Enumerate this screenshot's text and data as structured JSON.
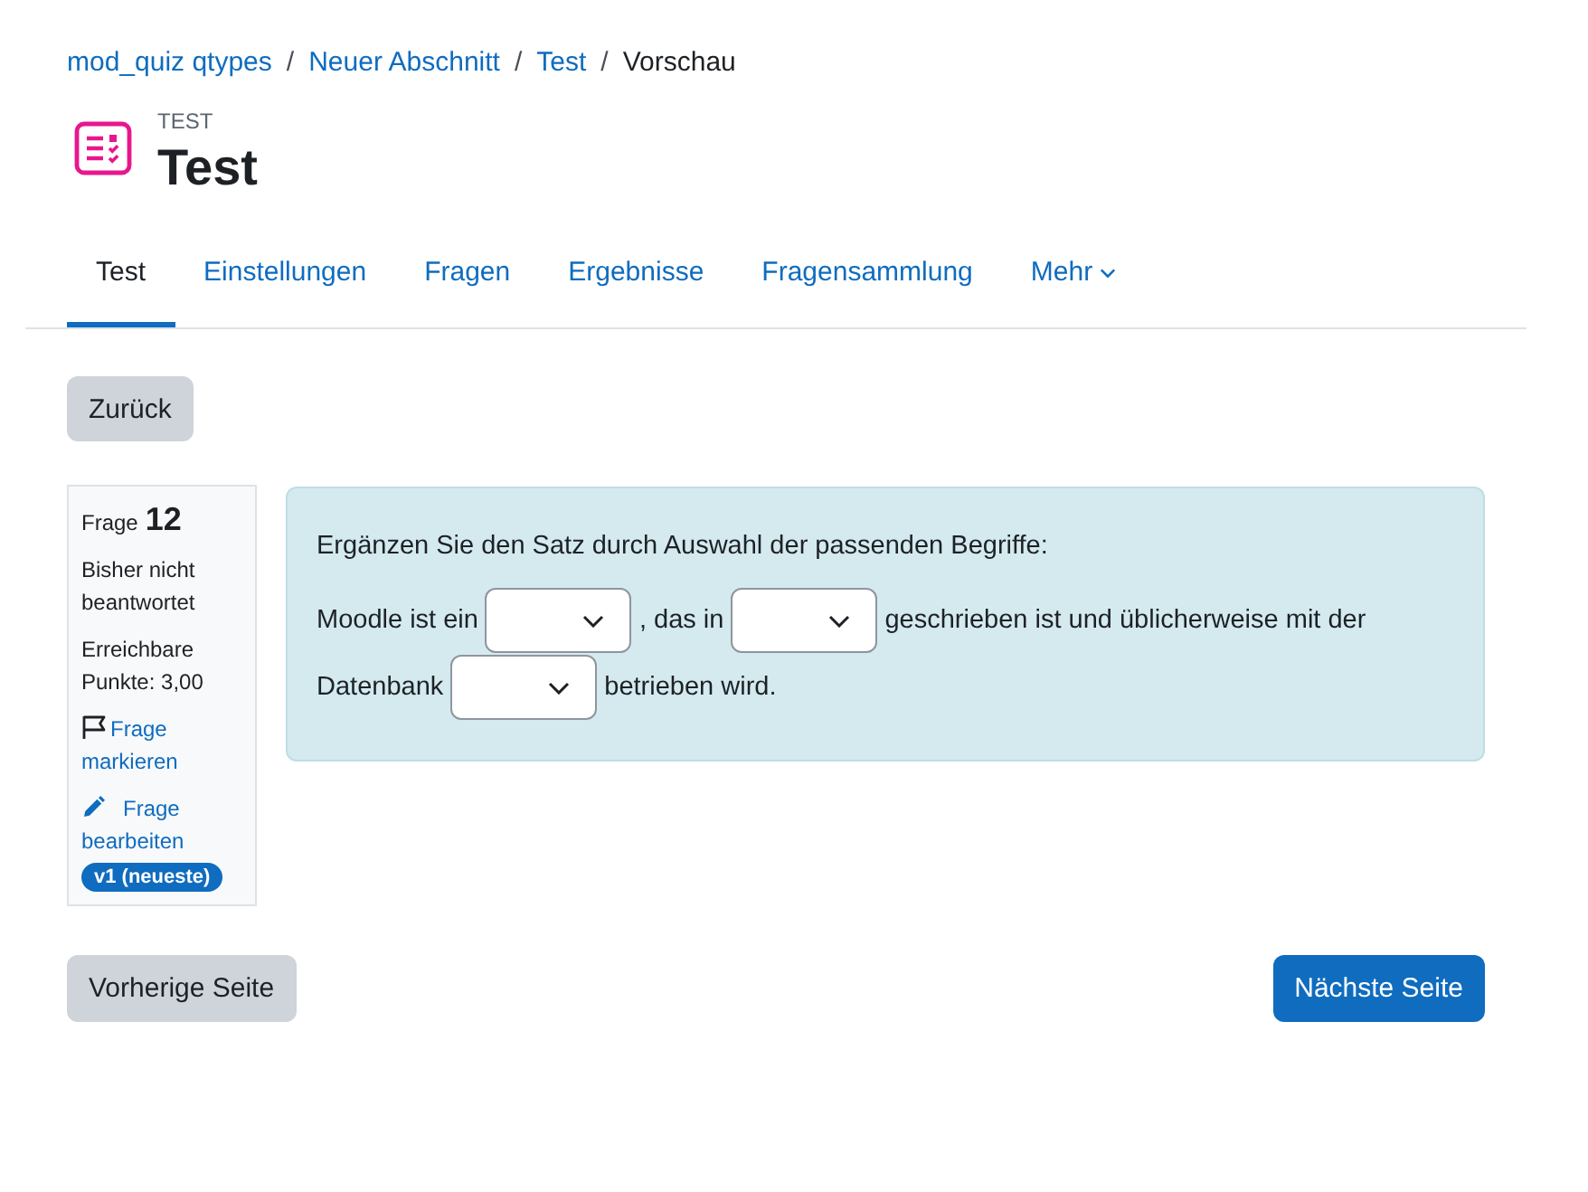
{
  "breadcrumb": {
    "separator": "/",
    "items": [
      {
        "label": "mod_quiz qtypes",
        "current": false
      },
      {
        "label": "Neuer Abschnitt",
        "current": false
      },
      {
        "label": "Test",
        "current": false
      },
      {
        "label": "Vorschau",
        "current": true
      }
    ]
  },
  "header": {
    "kicker": "TEST",
    "title": "Test"
  },
  "tabs": [
    {
      "label": "Test",
      "selected": true,
      "kind": "link"
    },
    {
      "label": "Einstellungen",
      "selected": false,
      "kind": "link"
    },
    {
      "label": "Fragen",
      "selected": false,
      "kind": "link"
    },
    {
      "label": "Ergebnisse",
      "selected": false,
      "kind": "link"
    },
    {
      "label": "Fragensammlung",
      "selected": false,
      "kind": "link"
    },
    {
      "label": "Mehr",
      "selected": false,
      "kind": "menu"
    }
  ],
  "back_button": "Zurück",
  "question_info": {
    "label": "Frage",
    "number": "12",
    "status": "Bisher nicht beantwortet",
    "marks": "Erreichbare Punkte: 3,00",
    "flag_link": "Frage markieren",
    "edit_link": "Frage bearbeiten",
    "version_badge": "v1 (neueste)"
  },
  "question": {
    "prompt": "Ergänzen Sie den Satz durch Auswahl der passenden Begriffe:",
    "parts": [
      {
        "kind": "text",
        "text": "Moodle ist ein"
      },
      {
        "kind": "select"
      },
      {
        "kind": "text",
        "text": ", das in"
      },
      {
        "kind": "select"
      },
      {
        "kind": "text",
        "text": "geschrieben ist und üblicherweise mit der"
      },
      {
        "kind": "text",
        "text": "Datenbank"
      },
      {
        "kind": "select"
      },
      {
        "kind": "text",
        "text": "betrieben wird."
      }
    ]
  },
  "navigation": {
    "previous": "Vorherige Seite",
    "next": "Nächste Seite"
  }
}
